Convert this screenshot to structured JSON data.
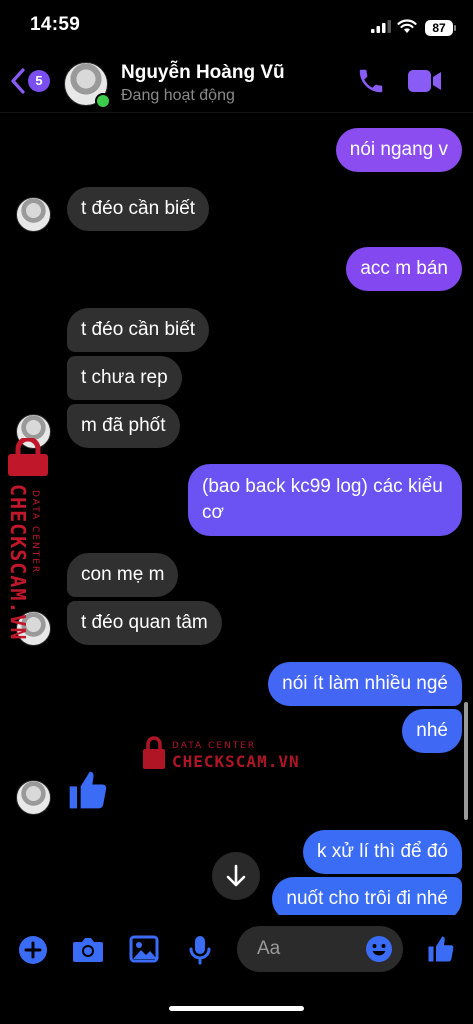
{
  "status_bar": {
    "time": "14:59",
    "battery": "87"
  },
  "header": {
    "back_badge": "5",
    "contact_name": "Nguyễn Hoàng Vũ",
    "contact_status": "Đang hoạt động"
  },
  "messages": [
    {
      "dir": "out",
      "text": "nói ngang v"
    },
    {
      "dir": "in",
      "text": "t đéo cần biết"
    },
    {
      "dir": "out",
      "text": "acc m bán"
    },
    {
      "dir": "in",
      "text": "t đéo cần biết"
    },
    {
      "dir": "in",
      "text": "t chưa rep"
    },
    {
      "dir": "in",
      "text": "m đã phốt"
    },
    {
      "dir": "out",
      "text": "(bao back kc99 log) các kiểu cơ"
    },
    {
      "dir": "in",
      "text": "con mẹ m"
    },
    {
      "dir": "in",
      "text": "t đéo quan tâm"
    },
    {
      "dir": "out",
      "text": "nói ít làm nhiều ngé"
    },
    {
      "dir": "out",
      "text": "nhé"
    },
    {
      "dir": "out",
      "text": "k xử lí thì để đó"
    },
    {
      "dir": "out",
      "text": "nuốt cho trôi đi nhé"
    }
  ],
  "composer": {
    "placeholder": "Aa"
  },
  "watermark": {
    "line1": "DATA CENTER",
    "line2": "CHECKSCAM.VN"
  },
  "colors": {
    "accent": "#8a5cf6",
    "incoming": "#303030",
    "out_top": "#8b4cf0",
    "out_bottom": "#3a6cf5"
  }
}
